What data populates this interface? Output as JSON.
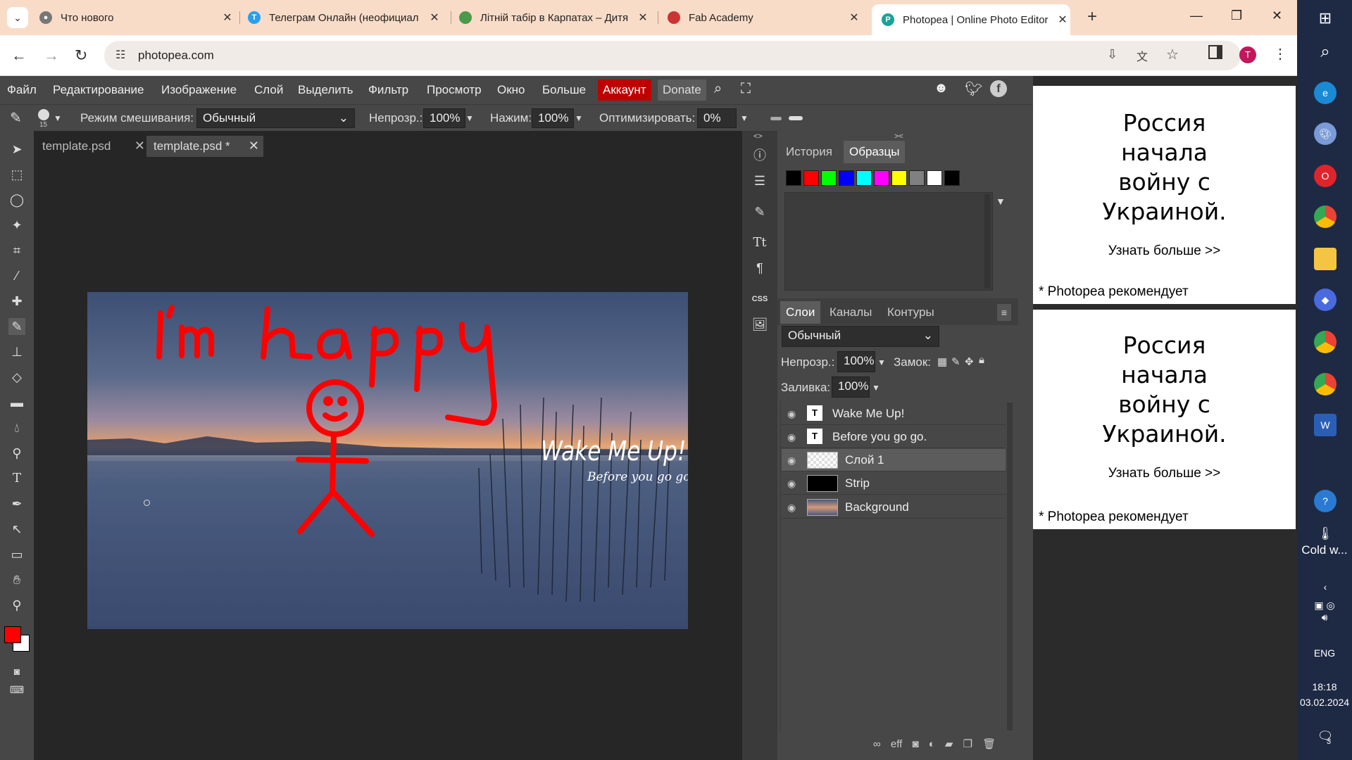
{
  "browser": {
    "tabs": [
      {
        "title": "Что нового"
      },
      {
        "title": "Телеграм Онлайн (неофициал"
      },
      {
        "title": "Літній табір в Карпатах – Дитя"
      },
      {
        "title": "Fab Academy"
      },
      {
        "title": "Photopea | Online Photo Editor"
      }
    ],
    "new_tab": "+",
    "url": "photopea.com",
    "profile_initial": "T"
  },
  "menu": {
    "items": [
      "Файл",
      "Редактирование",
      "Изображение",
      "Слой",
      "Выделить",
      "Фильтр",
      "Просмотр",
      "Окно",
      "Больше"
    ],
    "account": "Аккаунт",
    "donate": "Donate"
  },
  "options": {
    "brush_size": "15",
    "blend_label": "Режим смешивания:",
    "blend_value": "Обычный",
    "opacity_label": "Непрозр.:",
    "opacity_value": "100%",
    "pressure_label": "Нажим:",
    "pressure_value": "100%",
    "optimize_label": "Оптимизировать:",
    "optimize_value": "0%"
  },
  "documents": [
    {
      "name": "template.psd"
    },
    {
      "name": "template.psd *"
    }
  ],
  "canvas": {
    "title": "Wake Me Up!",
    "subtitle": "Before you go go.",
    "drawing_text": "I'm happy"
  },
  "panel_top": {
    "tabs": [
      "История",
      "Образцы"
    ],
    "css_label": "CSS",
    "swatches": [
      "#000000",
      "#ff0000",
      "#00ff00",
      "#0000ff",
      "#00ffff",
      "#ff00ff",
      "#ffff00",
      "#808080",
      "#ffffff",
      "#000000"
    ]
  },
  "layers_panel": {
    "tabs": [
      "Слои",
      "Каналы",
      "Контуры"
    ],
    "blend": "Обычный",
    "opacity_label": "Непрозр.:",
    "opacity_value": "100%",
    "lock_label": "Замок:",
    "fill_label": "Заливка:",
    "fill_value": "100%",
    "layers": [
      {
        "name": "Wake Me Up!",
        "type": "text"
      },
      {
        "name": "Before you go go.",
        "type": "text"
      },
      {
        "name": "Слой 1",
        "type": "raster",
        "selected": true
      },
      {
        "name": "Strip",
        "type": "raster"
      },
      {
        "name": "Background",
        "type": "image"
      }
    ]
  },
  "ads": [
    {
      "headline": "Россия\nначала\nвойну с\nУкраиной.",
      "more": "Узнать больше >>",
      "recommend": "* Photopea  рекомендует"
    },
    {
      "headline": "Россия\nначала\nвойну с\nУкраиной.",
      "more": "Узнать больше >>",
      "recommend": "* Photopea  рекомендует"
    }
  ],
  "taskbar": {
    "weather": "Cold w...",
    "lang": "ENG",
    "time": "18:18",
    "date": "03.02.2024",
    "notifications": "3"
  },
  "colors": {
    "foreground": "#ff0000",
    "background": "#ffffff",
    "account_bg": "#c00000"
  }
}
